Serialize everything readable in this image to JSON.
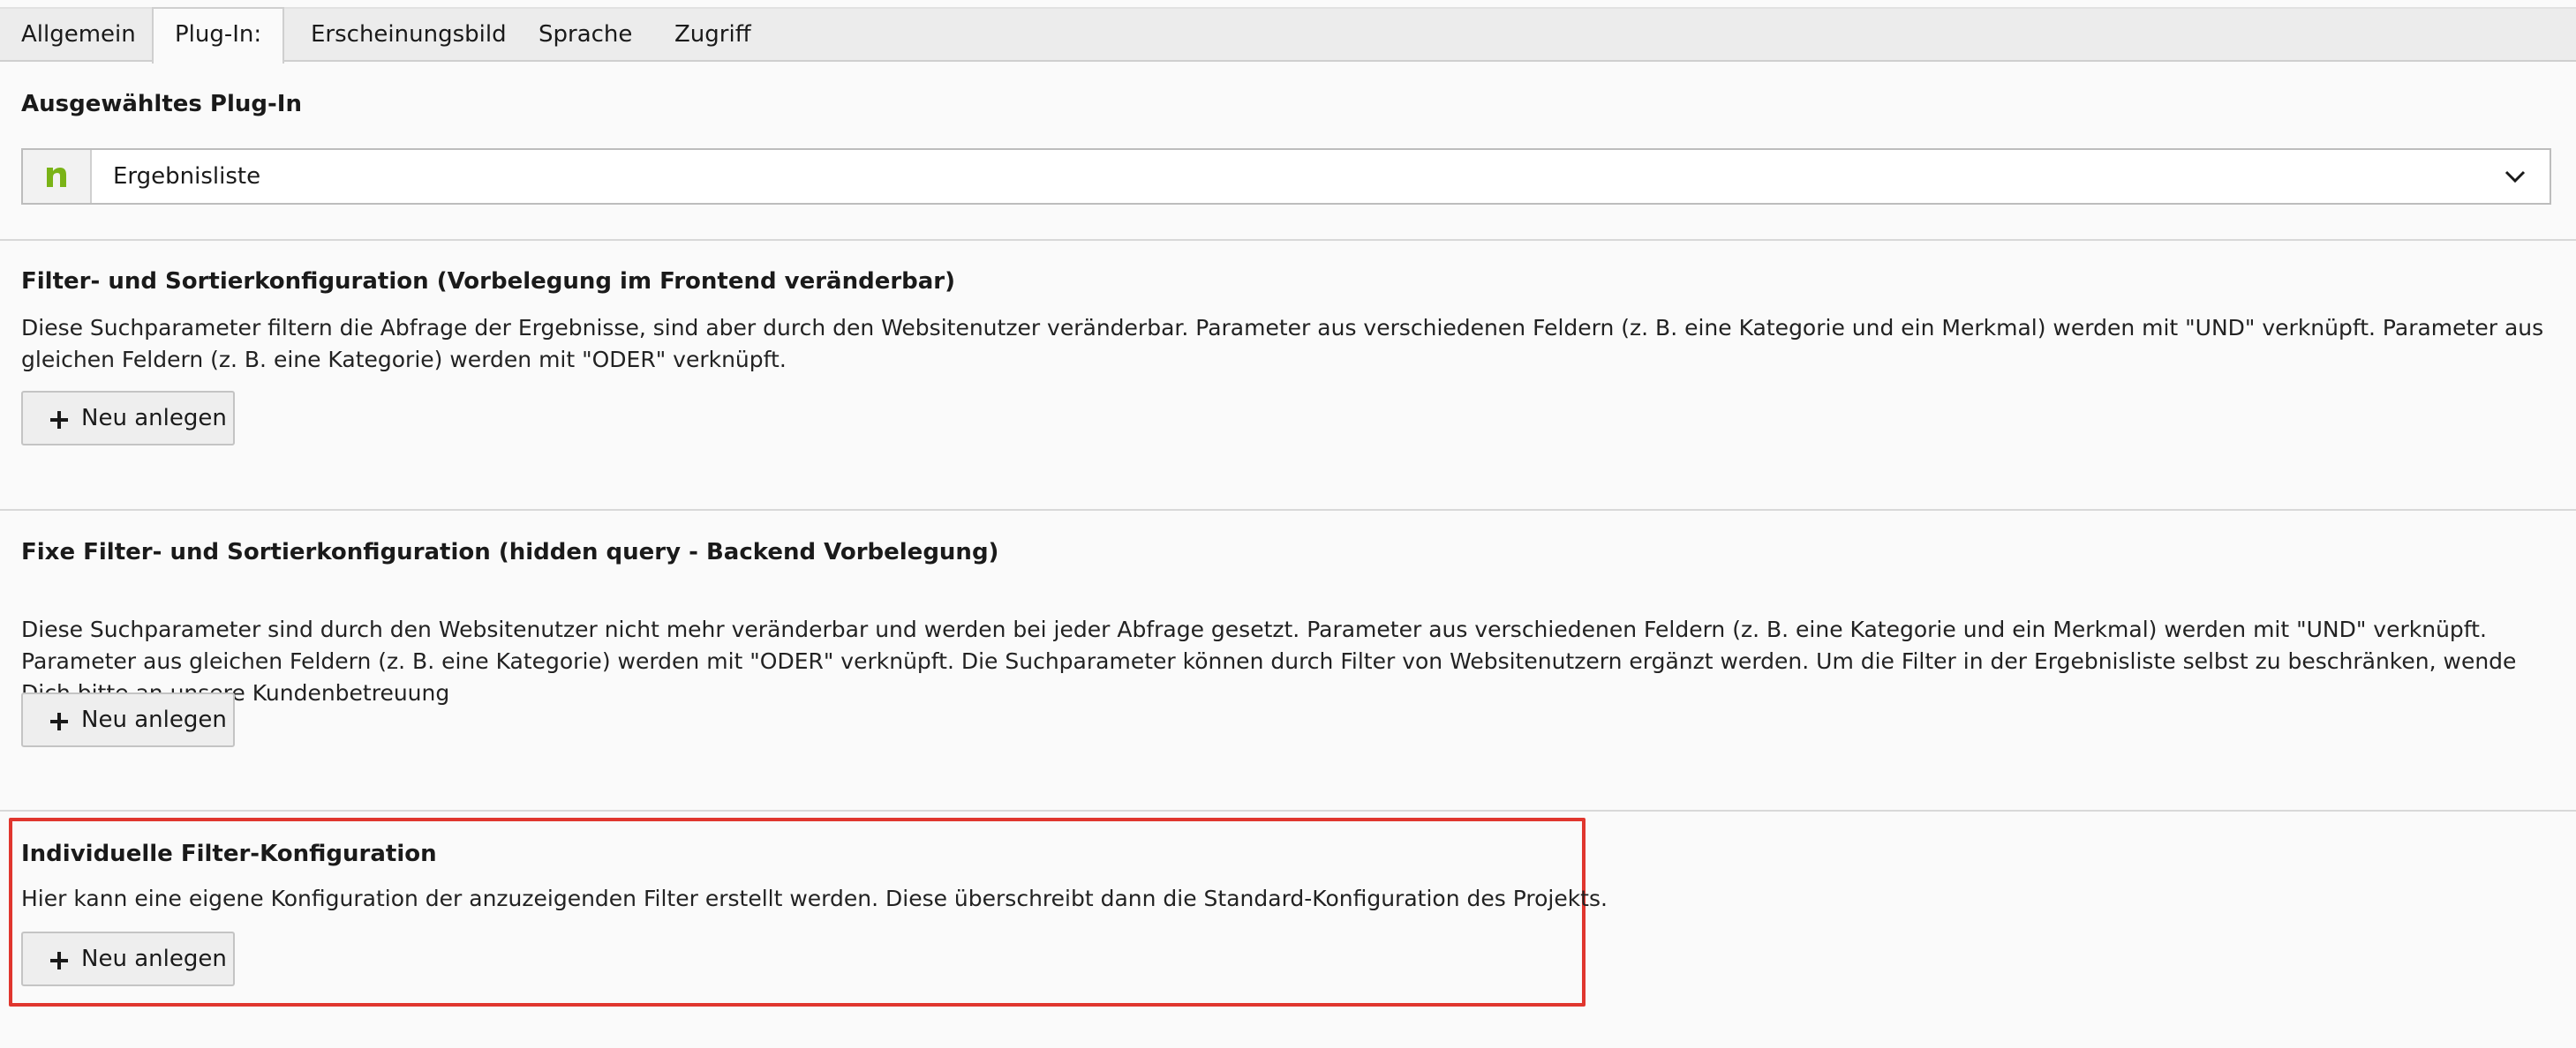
{
  "tabs": [
    {
      "label": "Allgemein",
      "active": false
    },
    {
      "label": "Plug-In:",
      "active": true
    },
    {
      "label": "Erscheinungsbild",
      "active": false
    },
    {
      "label": "Sprache",
      "active": false
    },
    {
      "label": "Zugriff",
      "active": false
    }
  ],
  "plugin": {
    "heading": "Ausgewähltes Plug-In",
    "selected_value": "Ergebnisliste",
    "icon": "plugin-logo-icon",
    "icon_color": "#7ab317"
  },
  "sections": [
    {
      "heading": "Filter- und Sortierkonfiguration (Vorbelegung im Frontend veränderbar)",
      "description": "Diese Suchparameter filtern die Abfrage der Ergebnisse, sind aber durch den Websitenutzer veränderbar. Parameter aus verschiedenen Feldern (z. B. eine Kategorie und ein Merkmal) werden mit \"UND\" verknüpft. Parameter aus gleichen Feldern (z. B. eine Kategorie) werden mit \"ODER\" verknüpft.",
      "button_label": "Neu anlegen"
    },
    {
      "heading": "Fixe Filter- und Sortierkonfiguration (hidden query - Backend Vorbelegung)",
      "description": "Diese Suchparameter sind durch den Websitenutzer nicht mehr veränderbar und werden bei jeder Abfrage gesetzt. Parameter aus verschiedenen Feldern (z. B. eine Kategorie und ein Merkmal) werden mit \"UND\" verknüpft. Parameter aus gleichen Feldern (z. B. eine Kategorie) werden mit \"ODER\" verknüpft. Die Suchparameter können durch Filter von Websitenutzern ergänzt werden. Um die Filter in der Ergebnisliste selbst zu beschränken, wende Dich bitte an unsere Kundenbetreuung",
      "button_label": "Neu anlegen"
    },
    {
      "heading": "Individuelle Filter-Konfiguration",
      "description": "Hier kann eine eigene Konfiguration der anzuzeigenden Filter erstellt werden. Diese überschreibt dann die Standard-Konfiguration des Projekts.",
      "button_label": "Neu anlegen"
    }
  ],
  "colors": {
    "highlight": "#e0362e",
    "background": "#fafafa",
    "tabbar": "#ececec"
  }
}
